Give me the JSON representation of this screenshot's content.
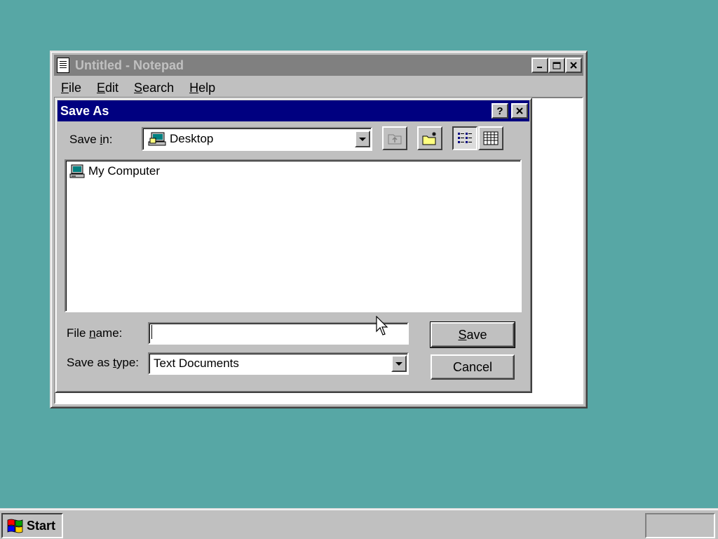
{
  "notepad": {
    "title": "Untitled - Notepad",
    "menu": [
      {
        "prefix": "",
        "accel": "F",
        "rest": "ile"
      },
      {
        "prefix": "",
        "accel": "E",
        "rest": "dit"
      },
      {
        "prefix": "",
        "accel": "S",
        "rest": "earch"
      },
      {
        "prefix": "",
        "accel": "H",
        "rest": "elp"
      }
    ],
    "controls": {
      "minimize": "_",
      "maximize": "□",
      "close": "✕"
    }
  },
  "dialog": {
    "title": "Save As",
    "help_glyph": "?",
    "close_glyph": "✕",
    "save_in": {
      "prefix": "Save ",
      "accel": "i",
      "rest": "n:",
      "value": "Desktop"
    },
    "toolbar": [
      "up-one-level-icon",
      "create-new-folder-icon",
      "list-view-icon",
      "details-view-icon"
    ],
    "file_list": [
      {
        "label": "My Computer",
        "icon": "my-computer-icon"
      }
    ],
    "file_name": {
      "prefix": "File ",
      "accel": "n",
      "rest": "ame:",
      "value": "",
      "placeholder": ""
    },
    "save_as_type": {
      "prefix": "Save as ",
      "accel": "t",
      "rest": "ype:",
      "value": "Text Documents"
    },
    "save_button": {
      "prefix": "",
      "accel": "S",
      "rest": "ave"
    },
    "cancel_button": "Cancel"
  },
  "taskbar": {
    "start_label": "Start"
  },
  "colors": {
    "desktop": "#57a7a5",
    "active_title": "#000080",
    "inactive_title": "#808080",
    "face": "#c0c0c0"
  }
}
